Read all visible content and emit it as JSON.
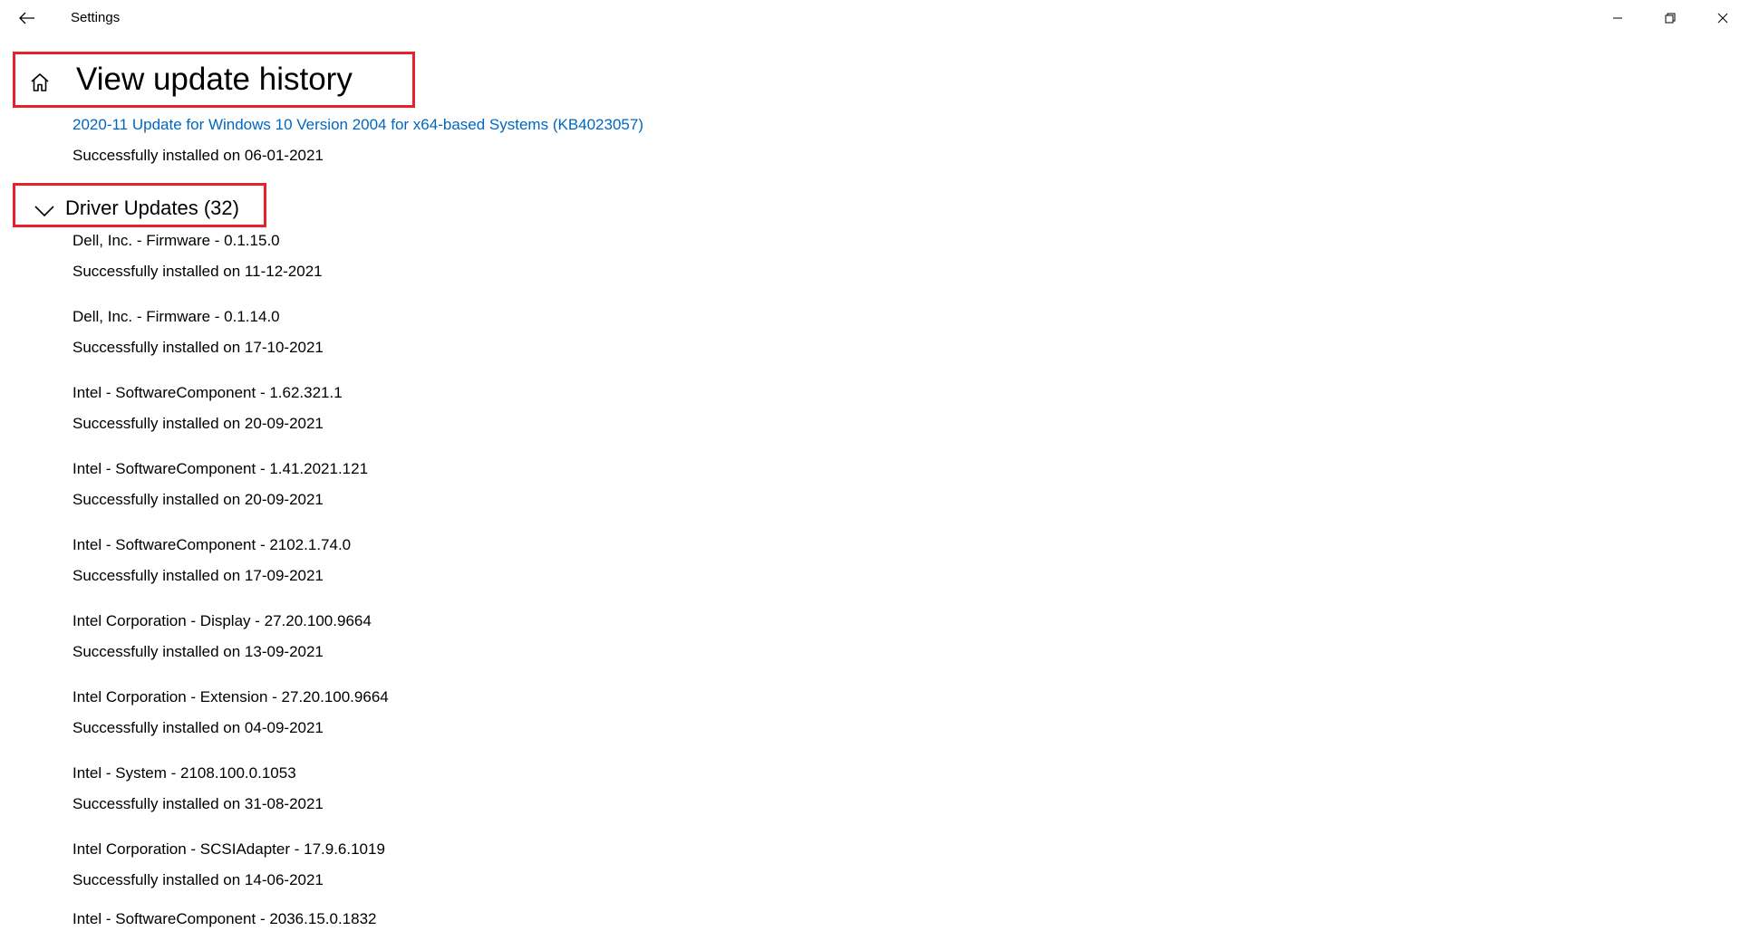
{
  "titlebar": {
    "back_icon": "arrow-left-icon",
    "title": "Settings",
    "minimize_icon": "minimize-icon",
    "maximize_icon": "restore-icon",
    "close_icon": "close-icon"
  },
  "header": {
    "home_icon": "home-icon",
    "title": "View update history",
    "highlight_color": "#e8202a"
  },
  "previous_section": {
    "last_item": {
      "name": "2020-11 Update for Windows 10 Version 2004 for x64-based Systems (KB4023057)",
      "status": "Successfully installed on 06-01-2021"
    }
  },
  "driver_section": {
    "chevron_icon": "chevron-down-icon",
    "title": "Driver Updates (32)",
    "items": [
      {
        "name": "Dell, Inc. - Firmware - 0.1.15.0",
        "status": "Successfully installed on 11-12-2021"
      },
      {
        "name": "Dell, Inc. - Firmware - 0.1.14.0",
        "status": "Successfully installed on 17-10-2021"
      },
      {
        "name": "Intel - SoftwareComponent - 1.62.321.1",
        "status": "Successfully installed on 20-09-2021"
      },
      {
        "name": "Intel - SoftwareComponent - 1.41.2021.121",
        "status": "Successfully installed on 20-09-2021"
      },
      {
        "name": "Intel - SoftwareComponent - 2102.1.74.0",
        "status": "Successfully installed on 17-09-2021"
      },
      {
        "name": "Intel Corporation - Display - 27.20.100.9664",
        "status": "Successfully installed on 13-09-2021"
      },
      {
        "name": "Intel Corporation - Extension - 27.20.100.9664",
        "status": "Successfully installed on 04-09-2021"
      },
      {
        "name": "Intel - System - 2108.100.0.1053",
        "status": "Successfully installed on 31-08-2021"
      },
      {
        "name": "Intel Corporation - SCSIAdapter - 17.9.6.1019",
        "status": "Successfully installed on 14-06-2021"
      },
      {
        "name": "Intel - SoftwareComponent - 2036.15.0.1832",
        "status": ""
      }
    ]
  },
  "colors": {
    "link": "#0067c0",
    "text": "#000000",
    "background": "#ffffff"
  }
}
